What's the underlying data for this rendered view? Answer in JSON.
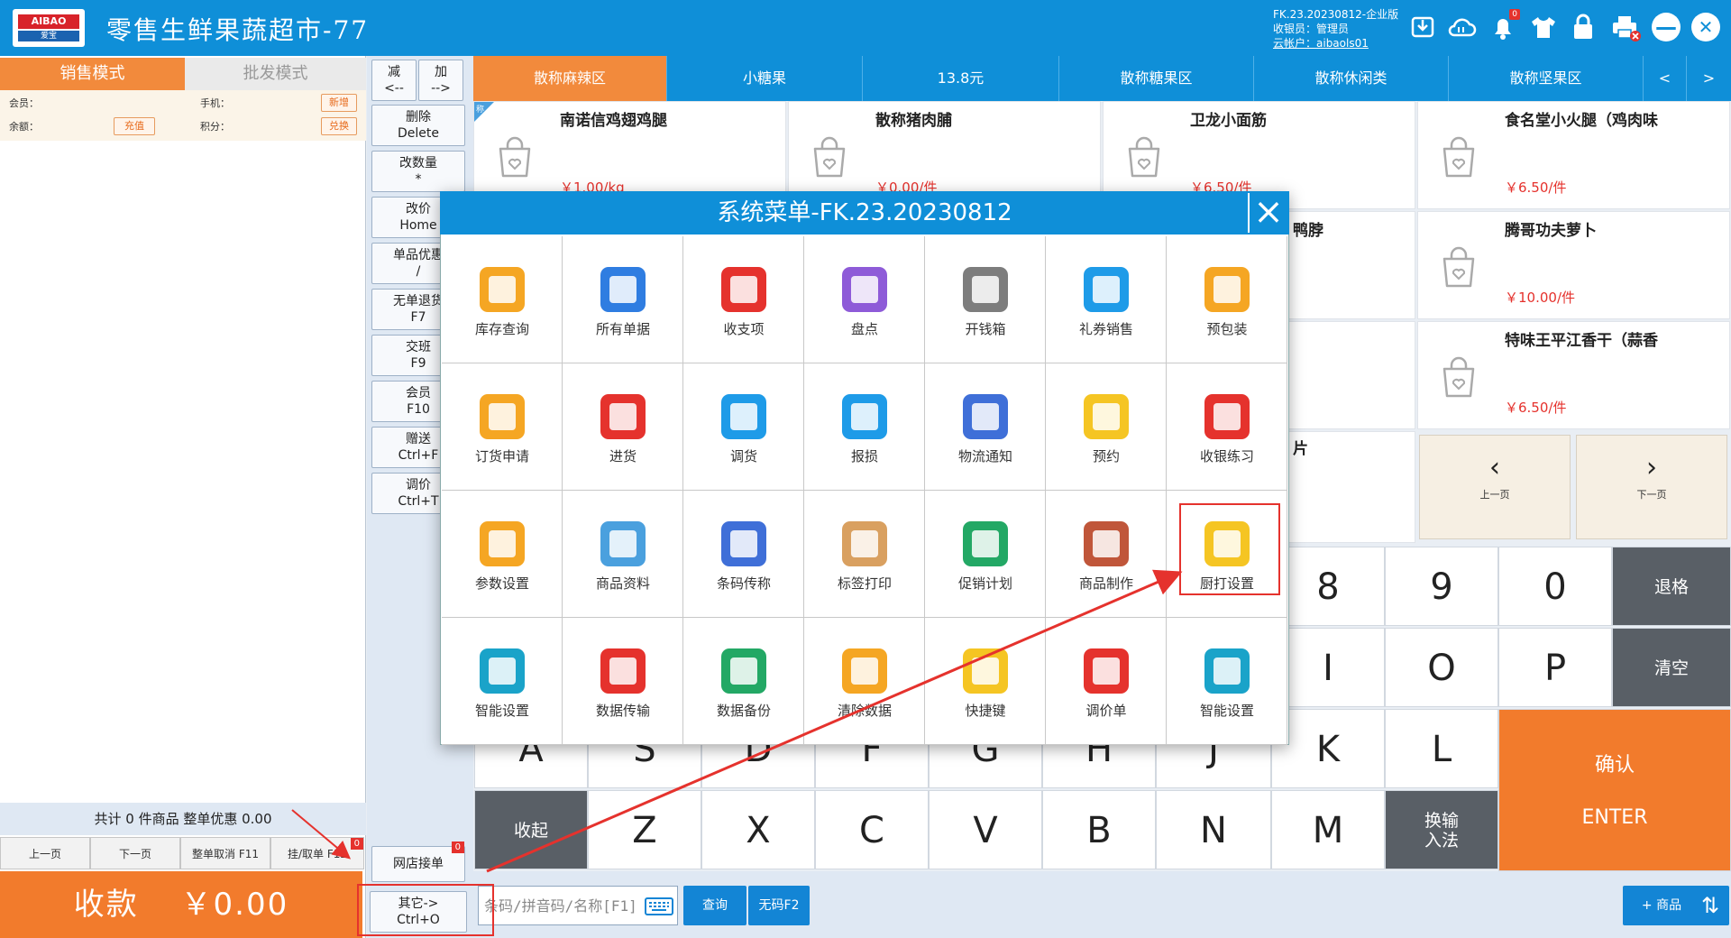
{
  "header": {
    "logo_top": "AIBAO",
    "logo_bottom": "爱宝",
    "title": "零售生鲜果蔬超市-77",
    "version": "FK.23.20230812-企业版",
    "cashier": "收银员：管理员",
    "cloud": "云帐户：aibaols01",
    "badge_count": "0",
    "icon_minimize": "—",
    "icon_close": "✕"
  },
  "left": {
    "tab_sale": "销售模式",
    "tab_wholesale": "批发模式",
    "member_label": "会员：",
    "phone_label": "手机：",
    "btn_new": "新增",
    "balance_label": "余额：",
    "btn_recharge": "充值",
    "points_label": "积分：",
    "btn_redeem": "兑换",
    "summary": "共计 0 件商品 整单优惠 0.00",
    "page_buttons": [
      "上一页",
      "下一页",
      "整单取消 F11",
      "挂/取单 F12"
    ],
    "hang_badge": "0",
    "pay_label": "收款",
    "pay_amount": "￥0.00"
  },
  "functions": {
    "minus_top": "减",
    "minus_bot": "<--",
    "plus_top": "加",
    "plus_bot": "-->",
    "delete_top": "删除",
    "delete_bot": "Delete",
    "qty_top": "改数量",
    "qty_bot": "*",
    "price_top": "改价",
    "price_bot": "Home",
    "disc_top": "单品优惠",
    "disc_bot": "/",
    "refund_top": "无单退货",
    "refund_bot": "F7",
    "shift_top": "交班",
    "shift_bot": "F9",
    "member_top": "会员",
    "member_bot": "F10",
    "gift_top": "赠送",
    "gift_bot": "Ctrl+F",
    "adjust_top": "调价",
    "adjust_bot": "Ctrl+T",
    "online_label": "网店接单",
    "online_badge": "0",
    "other_top": "其它->",
    "other_bot": "Ctrl+O"
  },
  "categories": [
    "散称麻辣区",
    "小糖果",
    "13.8元",
    "散称糖果区",
    "散称休闲类",
    "散称坚果区",
    "<",
    ">"
  ],
  "products": [
    {
      "name": "南诺信鸡翅鸡腿",
      "price": "￥1.00/kg",
      "tag": "称"
    },
    {
      "name": "散称猪肉脯",
      "price": "￥0.00/件"
    },
    {
      "name": "卫龙小面筋",
      "price": "￥6.50/件"
    },
    {
      "name": "食名堂小火腿（鸡肉味",
      "price": "￥6.50/件"
    },
    {
      "name": "腾哥功夫萝卜",
      "price": "￥10.00/件"
    },
    {
      "name": "特味王平江香干（蒜香",
      "price": "￥6.50/件"
    }
  ],
  "partial_texts": [
    "鸭脖",
    "片"
  ],
  "pager": {
    "prev": "上一页",
    "next": "下一页"
  },
  "keys": {
    "row1": [
      "8",
      "9",
      "0"
    ],
    "row2": [
      "I",
      "O",
      "P"
    ],
    "row3": [
      "A",
      "S",
      "D",
      "F",
      "G",
      "H",
      "J",
      "K",
      "L"
    ],
    "row4": [
      "Z",
      "X",
      "C",
      "V",
      "B",
      "N",
      "M"
    ],
    "backspace": "退格",
    "clear": "清空",
    "collapse": "收起",
    "ime_top": "换输",
    "ime_bot": "入法",
    "enter_top": "确认",
    "enter_bot": "ENTER"
  },
  "bottom": {
    "search_placeholder": "条码/拼音码/名称[F1]",
    "query": "查询",
    "nocode": "无码F2",
    "add_product": "+ 商品"
  },
  "dialog": {
    "title": "系统菜单-FK.23.20230812",
    "items": [
      {
        "label": "库存查询",
        "color": "#f5a623"
      },
      {
        "label": "所有单据",
        "color": "#2f7de1"
      },
      {
        "label": "收支项",
        "color": "#e5322d"
      },
      {
        "label": "盘点",
        "color": "#8e5bd8"
      },
      {
        "label": "开钱箱",
        "color": "#7d7d7d"
      },
      {
        "label": "礼券销售",
        "color": "#1e9be8"
      },
      {
        "label": "预包装",
        "color": "#f5a623"
      },
      {
        "label": "订货申请",
        "color": "#f5a623"
      },
      {
        "label": "进货",
        "color": "#e5322d"
      },
      {
        "label": "调货",
        "color": "#1e9be8"
      },
      {
        "label": "报损",
        "color": "#1e9be8"
      },
      {
        "label": "物流通知",
        "color": "#3f6fd8"
      },
      {
        "label": "预约",
        "color": "#f5c523"
      },
      {
        "label": "收银练习",
        "color": "#e5322d"
      },
      {
        "label": "参数设置",
        "color": "#f5a623"
      },
      {
        "label": "商品资料",
        "color": "#4aa0de"
      },
      {
        "label": "条码传称",
        "color": "#3f6fd8"
      },
      {
        "label": "标签打印",
        "color": "#d9a060"
      },
      {
        "label": "促销计划",
        "color": "#23a865"
      },
      {
        "label": "商品制作",
        "color": "#c0563a"
      },
      {
        "label": "厨打设置",
        "color": "#f5c523"
      },
      {
        "label": "智能设置",
        "color": "#1aa3c9"
      },
      {
        "label": "数据传输",
        "color": "#e5322d"
      },
      {
        "label": "数据备份",
        "color": "#23a865"
      },
      {
        "label": "清除数据",
        "color": "#f5a623"
      },
      {
        "label": "快捷键",
        "color": "#f5c523"
      },
      {
        "label": "调价单",
        "color": "#e5322d"
      },
      {
        "label": "智能设置",
        "color": "#1aa3c9"
      }
    ]
  }
}
